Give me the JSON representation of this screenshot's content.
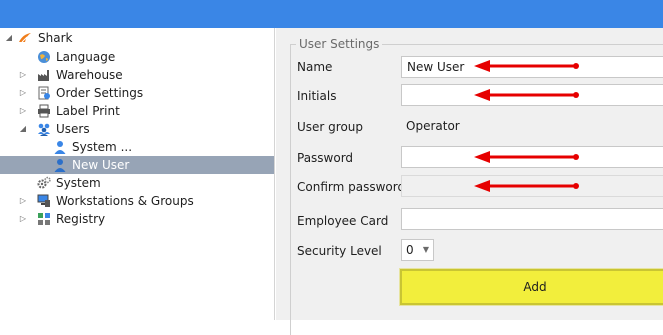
{
  "colors": {
    "titlebar": "#3a86e6",
    "selection": "#97a4b6",
    "add_highlight": "#f2ee3c",
    "annotation_arrow": "#e60000"
  },
  "tree": {
    "root": {
      "label": "Shark",
      "icon": "shark-logo-icon",
      "expanded": true
    },
    "items": [
      {
        "label": "Language",
        "icon": "globe-icon",
        "expandable": false
      },
      {
        "label": "Warehouse",
        "icon": "factory-icon",
        "expandable": true
      },
      {
        "label": "Order Settings",
        "icon": "order-settings-icon",
        "expandable": true
      },
      {
        "label": "Label Print",
        "icon": "printer-icon",
        "expandable": true
      },
      {
        "label": "Users",
        "icon": "users-icon",
        "expandable": true,
        "expanded": true
      },
      {
        "label": "System ...",
        "icon": "user-icon",
        "child": true
      },
      {
        "label": "New User",
        "icon": "user-icon",
        "child": true,
        "selected": true
      },
      {
        "label": "System",
        "icon": "gears-icon",
        "expandable": false
      },
      {
        "label": "Workstations & Groups",
        "icon": "workstation-icon",
        "expandable": true
      },
      {
        "label": "Registry",
        "icon": "registry-icon",
        "expandable": true
      }
    ]
  },
  "form": {
    "legend": "User Settings",
    "name_label": "Name",
    "name_value": "New User",
    "initials_label": "Initials",
    "initials_value": "",
    "user_group_label": "User group",
    "user_group_value": "Operator",
    "password_label": "Password",
    "password_value": "",
    "confirm_password_label": "Confirm password",
    "confirm_password_value": "",
    "employee_card_label": "Employee Card",
    "employee_card_value": "",
    "security_level_label": "Security Level",
    "security_level_value": "0",
    "add_label": "Add"
  }
}
